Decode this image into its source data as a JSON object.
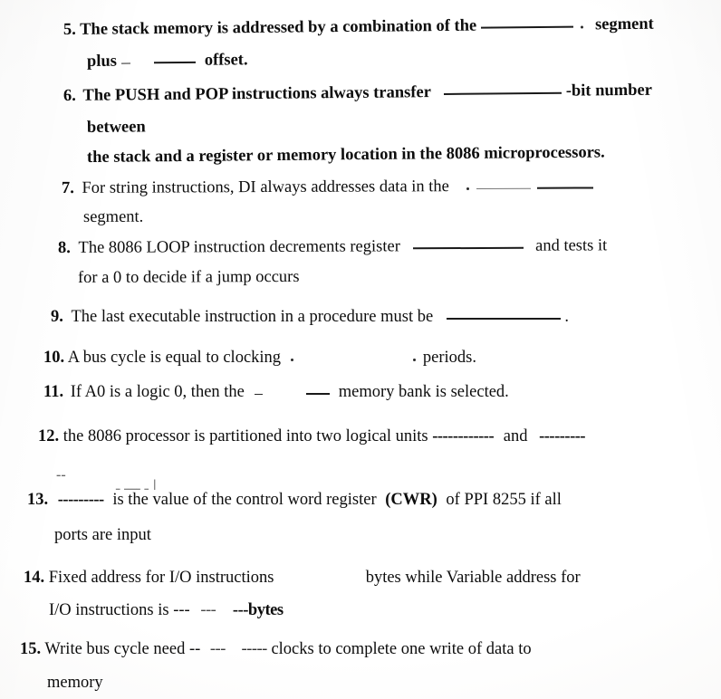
{
  "document": {
    "type": "scanned-worksheet",
    "subject_hint": "8086 microprocessor fill-in-the-blank questions",
    "background_color": "#fbfbfa",
    "text_color": "#0d0d0d"
  },
  "questions": [
    {
      "number": "5.",
      "line1_a": "The stack memory is addressed by a combination of the",
      "line1_b": "segment",
      "line2_a": "plus",
      "line2_b": "offset."
    },
    {
      "number": "6.",
      "line1_a": "The PUSH and POP instructions always transfer",
      "line1_b": "-bit number",
      "line2": "between",
      "line3": "the stack and a register or memory location in the 8086 microprocessors."
    },
    {
      "number": "7.",
      "line1": "For  string  instructions,  DI  always  addresses  data  in  the",
      "line2": "segment."
    },
    {
      "number": "8.",
      "line1_a": "The 8086 LOOP instruction decrements register",
      "line1_b": "and tests it",
      "line2": "for a 0 to decide if a jump occurs"
    },
    {
      "number": "9.",
      "line1_a": "The last executable instruction in a procedure must be",
      "line1_b": "."
    },
    {
      "number": "10.",
      "line1_a": "A bus cycle is equal to clocking",
      "line1_b": "periods."
    },
    {
      "number": "11.",
      "line1_a": "If A0 is a logic 0, then the",
      "line1_b": "memory bank is selected."
    },
    {
      "number": "12.",
      "line1_a": "the 8086 processor is partitioned into two logical units",
      "line1_dashes": "------------",
      "line1_b": "and",
      "line1_dashes2": "---------"
    },
    {
      "number": "13.",
      "line1_dashes": "---------",
      "line1_a": "is the value of the control word register",
      "line1_cwr": "(CWR)",
      "line1_b": "of PPI 8255 if all",
      "line2": "ports are input",
      "annotation": "ا ـ ــــ ـ"
    },
    {
      "number": "14.",
      "line1_a": "Fixed address for I/O instructions",
      "line1_b": "bytes while Variable address for",
      "line2_a": "I/O instructions is ---",
      "line2_mid": "---",
      "line2_b": "---bytes"
    },
    {
      "number": "15.",
      "line1_a": "Write   bus cycle need --",
      "line1_mid": "---",
      "line1_dashes": "-----",
      "line1_b": "clocks to complete one write of data to",
      "line2": "memory"
    }
  ],
  "stray_marks": {
    "mark_above_13": "--"
  }
}
